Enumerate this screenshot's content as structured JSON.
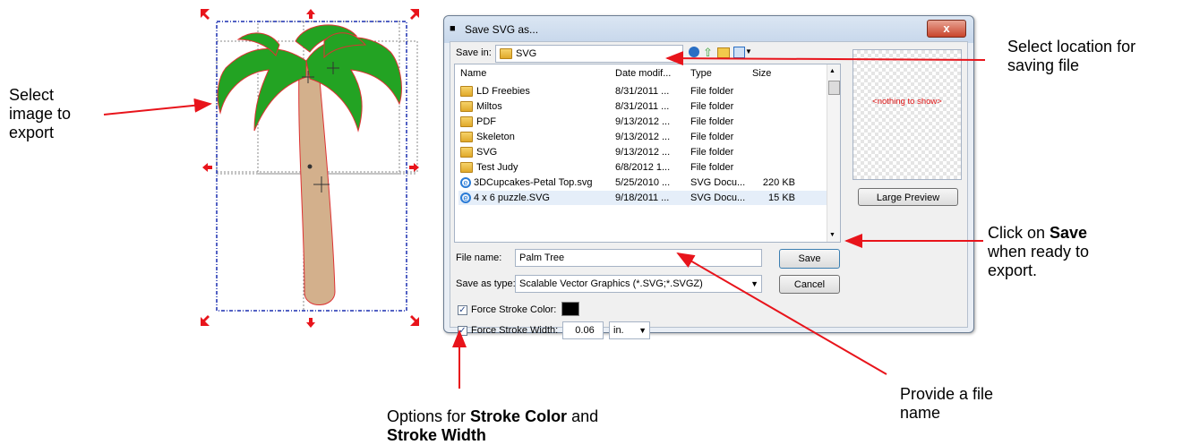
{
  "annotations": {
    "select_image": [
      "Select",
      "image to",
      "export"
    ],
    "select_location": [
      "Select location for",
      "saving file"
    ],
    "click_save": {
      "pre": "Click on ",
      "bold": "Save",
      "post": "when ready to",
      "post2": "export."
    },
    "file_name": [
      "Provide a file",
      "name"
    ],
    "stroke_opts": {
      "pre": "Options for ",
      "bold1": "Stroke Color",
      "mid": " and",
      "bold2": "Stroke Width"
    }
  },
  "dialog": {
    "title": "Save SVG as...",
    "close_label": "x",
    "save_in_label": "Save in:",
    "save_in_value": "SVG",
    "columns": [
      "Name",
      "Date modif...",
      "Type",
      "Size"
    ],
    "files": [
      {
        "name": "LD Freebies",
        "date": "8/31/2011 ...",
        "type": "File folder",
        "size": "",
        "icon": "folder-icon"
      },
      {
        "name": "Miltos",
        "date": "8/31/2011 ...",
        "type": "File folder",
        "size": "",
        "icon": "folder-icon"
      },
      {
        "name": "PDF",
        "date": "9/13/2012 ...",
        "type": "File folder",
        "size": "",
        "icon": "folder-icon"
      },
      {
        "name": "Skeleton",
        "date": "9/13/2012 ...",
        "type": "File folder",
        "size": "",
        "icon": "folder-icon"
      },
      {
        "name": "SVG",
        "date": "9/13/2012 ...",
        "type": "File folder",
        "size": "",
        "icon": "folder-icon"
      },
      {
        "name": "Test Judy",
        "date": "6/8/2012 1...",
        "type": "File folder",
        "size": "",
        "icon": "folder-icon"
      },
      {
        "name": "3DCupcakes-Petal Top.svg",
        "date": "5/25/2010 ...",
        "type": "SVG Docu...",
        "size": "220 KB",
        "icon": "svg-file-icon"
      },
      {
        "name": "4 x 6 puzzle.SVG",
        "date": "9/18/2011 ...",
        "type": "SVG Docu...",
        "size": "15 KB",
        "icon": "svg-file-icon"
      }
    ],
    "preview_text": "<nothing to show>",
    "large_preview_label": "Large Preview",
    "file_name_label": "File name:",
    "file_name_value": "Palm Tree",
    "save_label": "Save",
    "save_as_type_label": "Save as type:",
    "save_as_type_value": "Scalable Vector Graphics (*.SVG;*.SVGZ)",
    "cancel_label": "Cancel",
    "force_stroke_color_label": "Force Stroke Color:",
    "force_stroke_color_value": "#000000",
    "force_stroke_width_label": "Force Stroke Width:",
    "force_stroke_width_value": "0.06",
    "units_value": "in."
  },
  "colors": {
    "arrow": "#e8141b",
    "selection": "#1a2fb0",
    "leaves": "#23a323",
    "trunk": "#d3b08c"
  }
}
